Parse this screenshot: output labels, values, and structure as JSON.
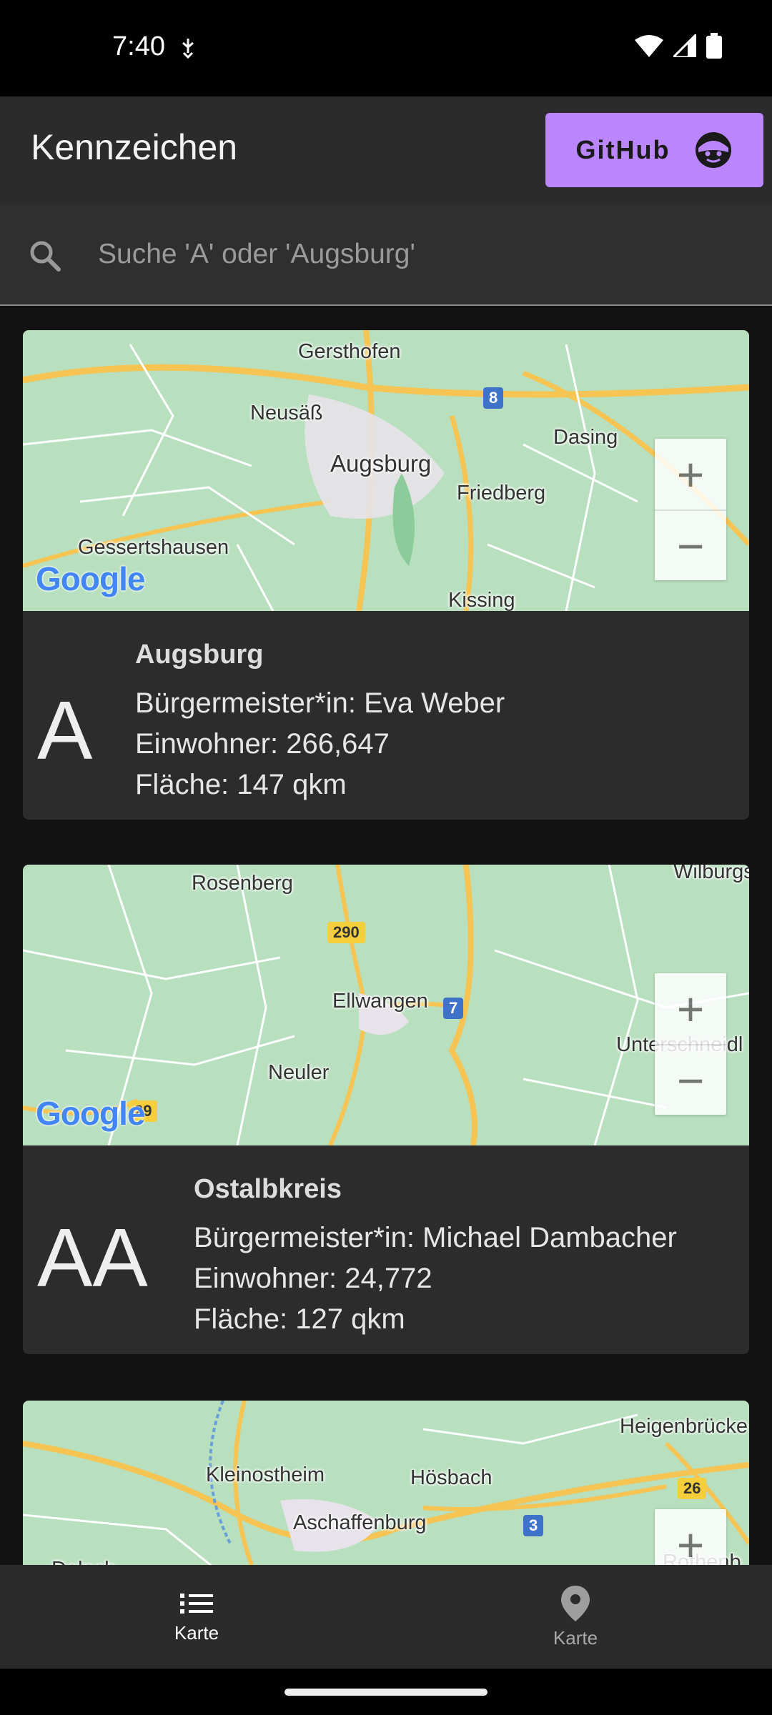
{
  "status_bar": {
    "time": "7:40"
  },
  "app_bar": {
    "title": "Kennzeichen",
    "github_label": "GitHub"
  },
  "search": {
    "placeholder": "Suche 'A' oder 'Augsburg'",
    "value": ""
  },
  "colors": {
    "accent": "#bb86fc",
    "surface": "#2b2b2b",
    "background": "#121212",
    "map_green": "#b8dfbe",
    "road": "#f6c453"
  },
  "cards": [
    {
      "plate": "A",
      "city": "Augsburg",
      "mayor": "Bürgermeister*in: Eva Weber",
      "population": "Einwohner: 266,647",
      "area": "Fläche: 147 qkm",
      "map": {
        "labels": [
          "Gersthofen",
          "Neusäß",
          "Augsburg",
          "Friedberg",
          "Dasing",
          "Gessertshausen",
          "Kissing"
        ],
        "shields": [
          "8"
        ],
        "zoom_in": "+",
        "zoom_out": "−",
        "logo": "Google"
      }
    },
    {
      "plate": "AA",
      "city": "Ostalbkreis",
      "mayor": "Bürgermeister*in: Michael Dambacher",
      "population": "Einwohner: 24,772",
      "area": "Fläche: 127 qkm",
      "map": {
        "labels": [
          "Rosenberg",
          "Ellwangen",
          "Neuler",
          "Unterschneidl",
          "Wilburgs"
        ],
        "shields": [
          "290",
          "7",
          "29"
        ],
        "zoom_in": "+",
        "zoom_out": "−",
        "logo": "Google"
      }
    },
    {
      "map": {
        "labels": [
          "Heigenbrücke",
          "Kleinostheim",
          "Hösbach",
          "Aschaffenburg",
          "Rothenb",
          "Dalach"
        ],
        "shields": [
          "26",
          "3"
        ],
        "zoom_in": "+"
      }
    }
  ],
  "bottom_nav": [
    {
      "label": "Karte",
      "icon": "list-icon",
      "active": true
    },
    {
      "label": "Karte",
      "icon": "map-pin-icon",
      "active": false
    }
  ]
}
